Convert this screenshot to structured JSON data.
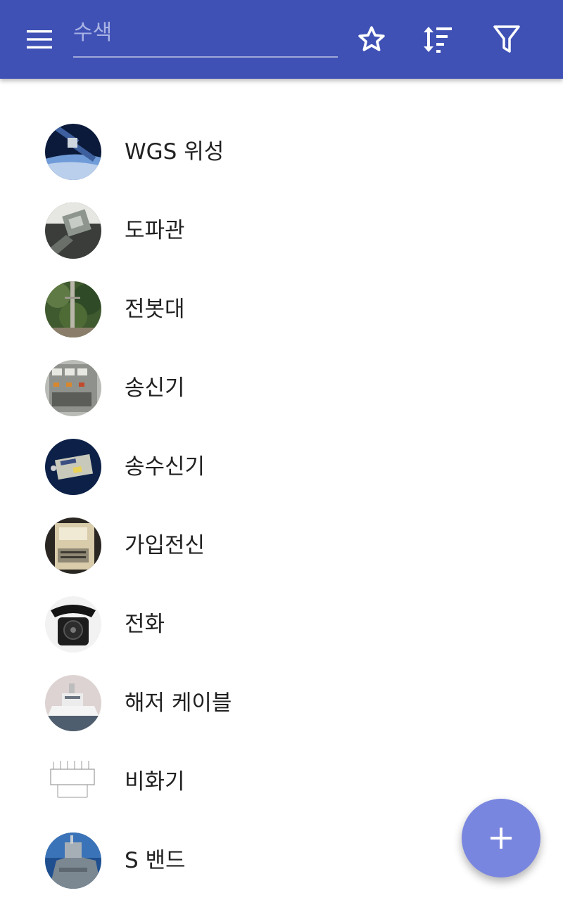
{
  "header": {
    "search_placeholder": "수색",
    "colors": {
      "app_bar": "#3f51b5",
      "fab": "#7986e0"
    },
    "icons": [
      "menu-icon",
      "star-icon",
      "sort-icon",
      "filter-icon"
    ]
  },
  "list": {
    "items": [
      {
        "label": "WGS 위성",
        "thumbnail": "satellite-thumbnail"
      },
      {
        "label": "도파관",
        "thumbnail": "waveguide-thumbnail"
      },
      {
        "label": "전봇대",
        "thumbnail": "utility-pole-thumbnail"
      },
      {
        "label": "송신기",
        "thumbnail": "transmitter-thumbnail"
      },
      {
        "label": "송수신기",
        "thumbnail": "transceiver-thumbnail"
      },
      {
        "label": "가입전신",
        "thumbnail": "telex-thumbnail"
      },
      {
        "label": "전화",
        "thumbnail": "telephone-thumbnail"
      },
      {
        "label": "해저 케이블",
        "thumbnail": "cable-ship-thumbnail"
      },
      {
        "label": "비화기",
        "thumbnail": "scrambler-diagram-thumbnail"
      },
      {
        "label": "S 밴드",
        "thumbnail": "radar-ship-thumbnail"
      }
    ]
  },
  "fab": {
    "icon": "plus-icon"
  }
}
